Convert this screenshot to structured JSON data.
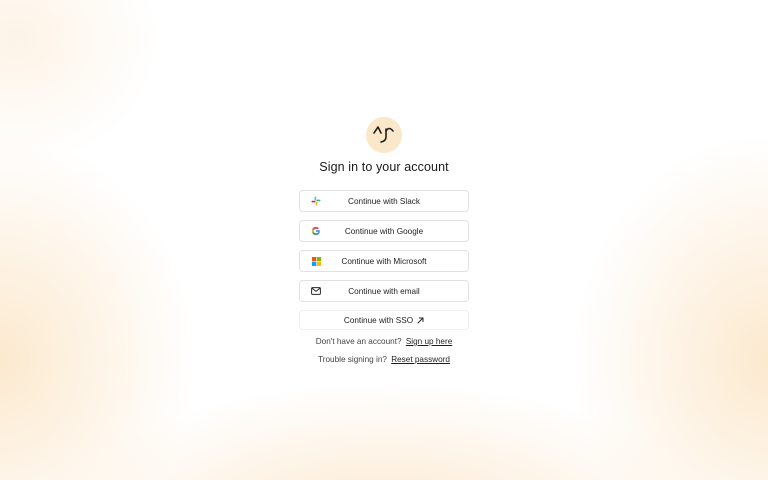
{
  "page_title": "Sign in to your account",
  "buttons": {
    "slack": "Continue with Slack",
    "google": "Continue with Google",
    "microsoft": "Continue with Microsoft",
    "email": "Continue with email",
    "sso": "Continue with SSO"
  },
  "signup": {
    "prompt": "Don't have an account?",
    "link": "Sign up here"
  },
  "reset": {
    "prompt": "Trouble signing in?",
    "link": "Reset password"
  },
  "icons": {
    "logo": "smiling-face-logo",
    "slack": "slack-icon",
    "google": "google-icon",
    "microsoft": "microsoft-icon",
    "email": "mail-icon",
    "sso": "external-link-icon"
  },
  "colors": {
    "logo_bg": "#fbe7c9",
    "button_border": "#e4e2de",
    "background_glow": "#fbe2be"
  }
}
